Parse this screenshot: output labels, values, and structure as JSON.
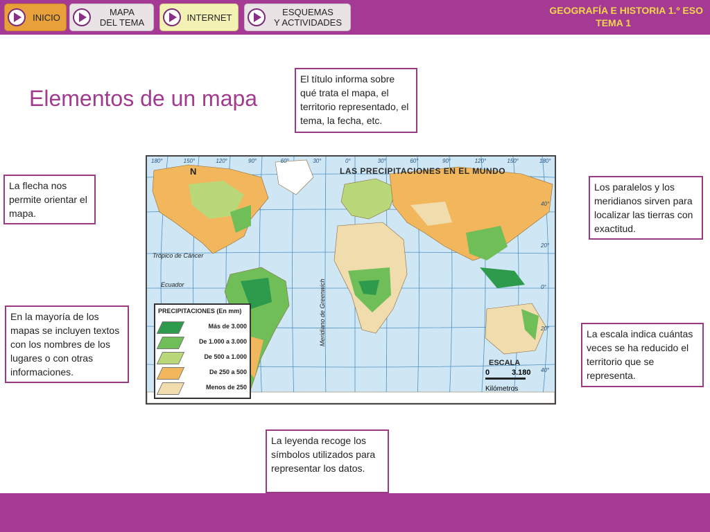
{
  "nav": {
    "inicio": "INICIO",
    "mapa_l1": "MAPA",
    "mapa_l2": "DEL TEMA",
    "internet": "INTERNET",
    "esquemas_l1": "ESQUEMAS",
    "esquemas_l2": "Y ACTIVIDADES"
  },
  "brand": {
    "line1": "GEOGRAFÍA E HISTORIA 1.º ESO",
    "line2": "TEMA 1"
  },
  "page_title": "Elementos de un mapa",
  "callouts": {
    "titulo": "El título informa sobre qué trata el mapa, el territorio representado, el tema, la fecha, etc.",
    "flecha": "La flecha nos permite orientar el mapa.",
    "paralelos": "Los paralelos y los meridianos sirven para localizar las tierras con exactitud.",
    "textos": "En la mayoría de los mapas se incluyen textos con los nombres de los lugares o con otras informaciones.",
    "escala": "La escala indica cuántas veces se ha reducido el territorio que se representa.",
    "leyenda": "La leyenda recoge los símbolos utilizados para representar los datos."
  },
  "map": {
    "title": "LAS PRECIPITACIONES EN EL MUNDO",
    "north": "N",
    "tropic": "Trópico de Cáncer",
    "equator": "Ecuador",
    "meridian": "Meridiano de Greenwich",
    "legend": {
      "title": "PRECIPITACIONES (En mm)",
      "items": [
        {
          "label": "Más de 3.000",
          "color": "#2e9a4c"
        },
        {
          "label": "De 1.000 a 3.000",
          "color": "#6fbe58"
        },
        {
          "label": "De 500 a 1.000",
          "color": "#b9d87a"
        },
        {
          "label": "De 250 a 500",
          "color": "#f2b65c"
        },
        {
          "label": "Menos de 250",
          "color": "#f1dcae"
        }
      ]
    },
    "scale": {
      "label": "ESCALA",
      "min": "0",
      "max": "3.180",
      "unit": "Kilómetros"
    },
    "top_ticks": [
      "180°",
      "150°",
      "120°",
      "90°",
      "60°",
      "30°",
      "0°",
      "30°",
      "60°",
      "90°",
      "120°",
      "150°",
      "180°"
    ],
    "side_ticks": [
      "40°",
      "20°",
      "0°",
      "20°",
      "40°"
    ]
  },
  "colors": {
    "brand_purple": "#a43a93",
    "title_purple": "#a23b90",
    "brand_yellow": "#f5d64b"
  }
}
